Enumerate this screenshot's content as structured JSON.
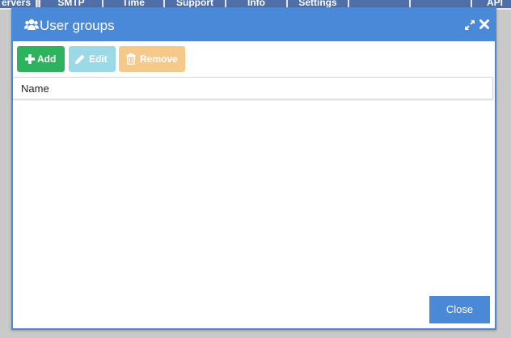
{
  "background_tabs": [
    "ervers",
    "SMTP",
    "Time",
    "Support",
    "Info",
    "Settings",
    "",
    "",
    "API"
  ],
  "dialog": {
    "title": "User groups",
    "title_icon": "users-icon",
    "controls": {
      "maximize_icon": "expand-icon",
      "close_icon": "close-icon"
    }
  },
  "toolbar": {
    "add_label": "Add",
    "edit_label": "Edit",
    "remove_label": "Remove"
  },
  "table": {
    "columns": [
      "Name"
    ],
    "rows": []
  },
  "footer": {
    "close_label": "Close"
  },
  "colors": {
    "title_bar": "#4a88d8",
    "add": "#2db35e",
    "edit": "#9ad9e5",
    "remove": "#f5c989",
    "close": "#4a88d8"
  }
}
